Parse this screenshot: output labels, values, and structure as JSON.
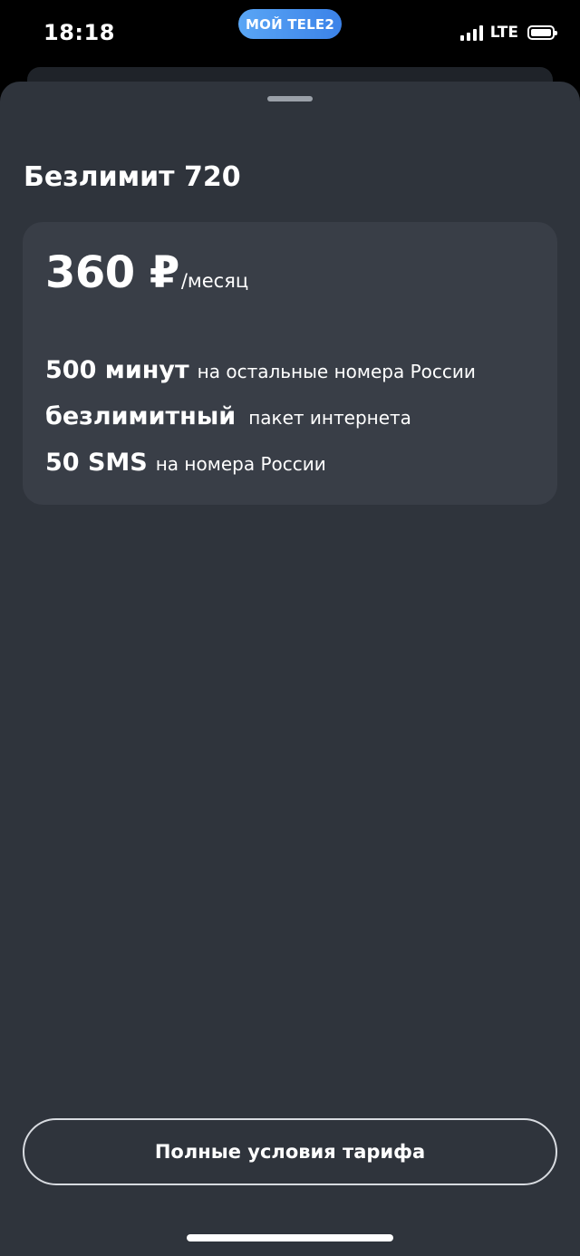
{
  "status_bar": {
    "time": "18:18",
    "app_pill": "МОЙ TELE2",
    "network": "LTE",
    "icons": [
      "signal-icon",
      "battery-icon"
    ]
  },
  "tariff": {
    "title": "Безлимит 720",
    "price": "360 ₽",
    "price_unit": "/месяц",
    "features": [
      {
        "main": "500 минут",
        "sub": "на остальные номера России"
      },
      {
        "main": "безлимитный",
        "sub": "пакет интернета"
      },
      {
        "main": "50 SMS",
        "sub": "на номера России"
      }
    ]
  },
  "actions": {
    "terms_label": "Полные условия тарифа"
  },
  "colors": {
    "sheet_bg": "#2f343c",
    "card_bg": "#393e47",
    "accent_pill": "#4a95ef"
  }
}
